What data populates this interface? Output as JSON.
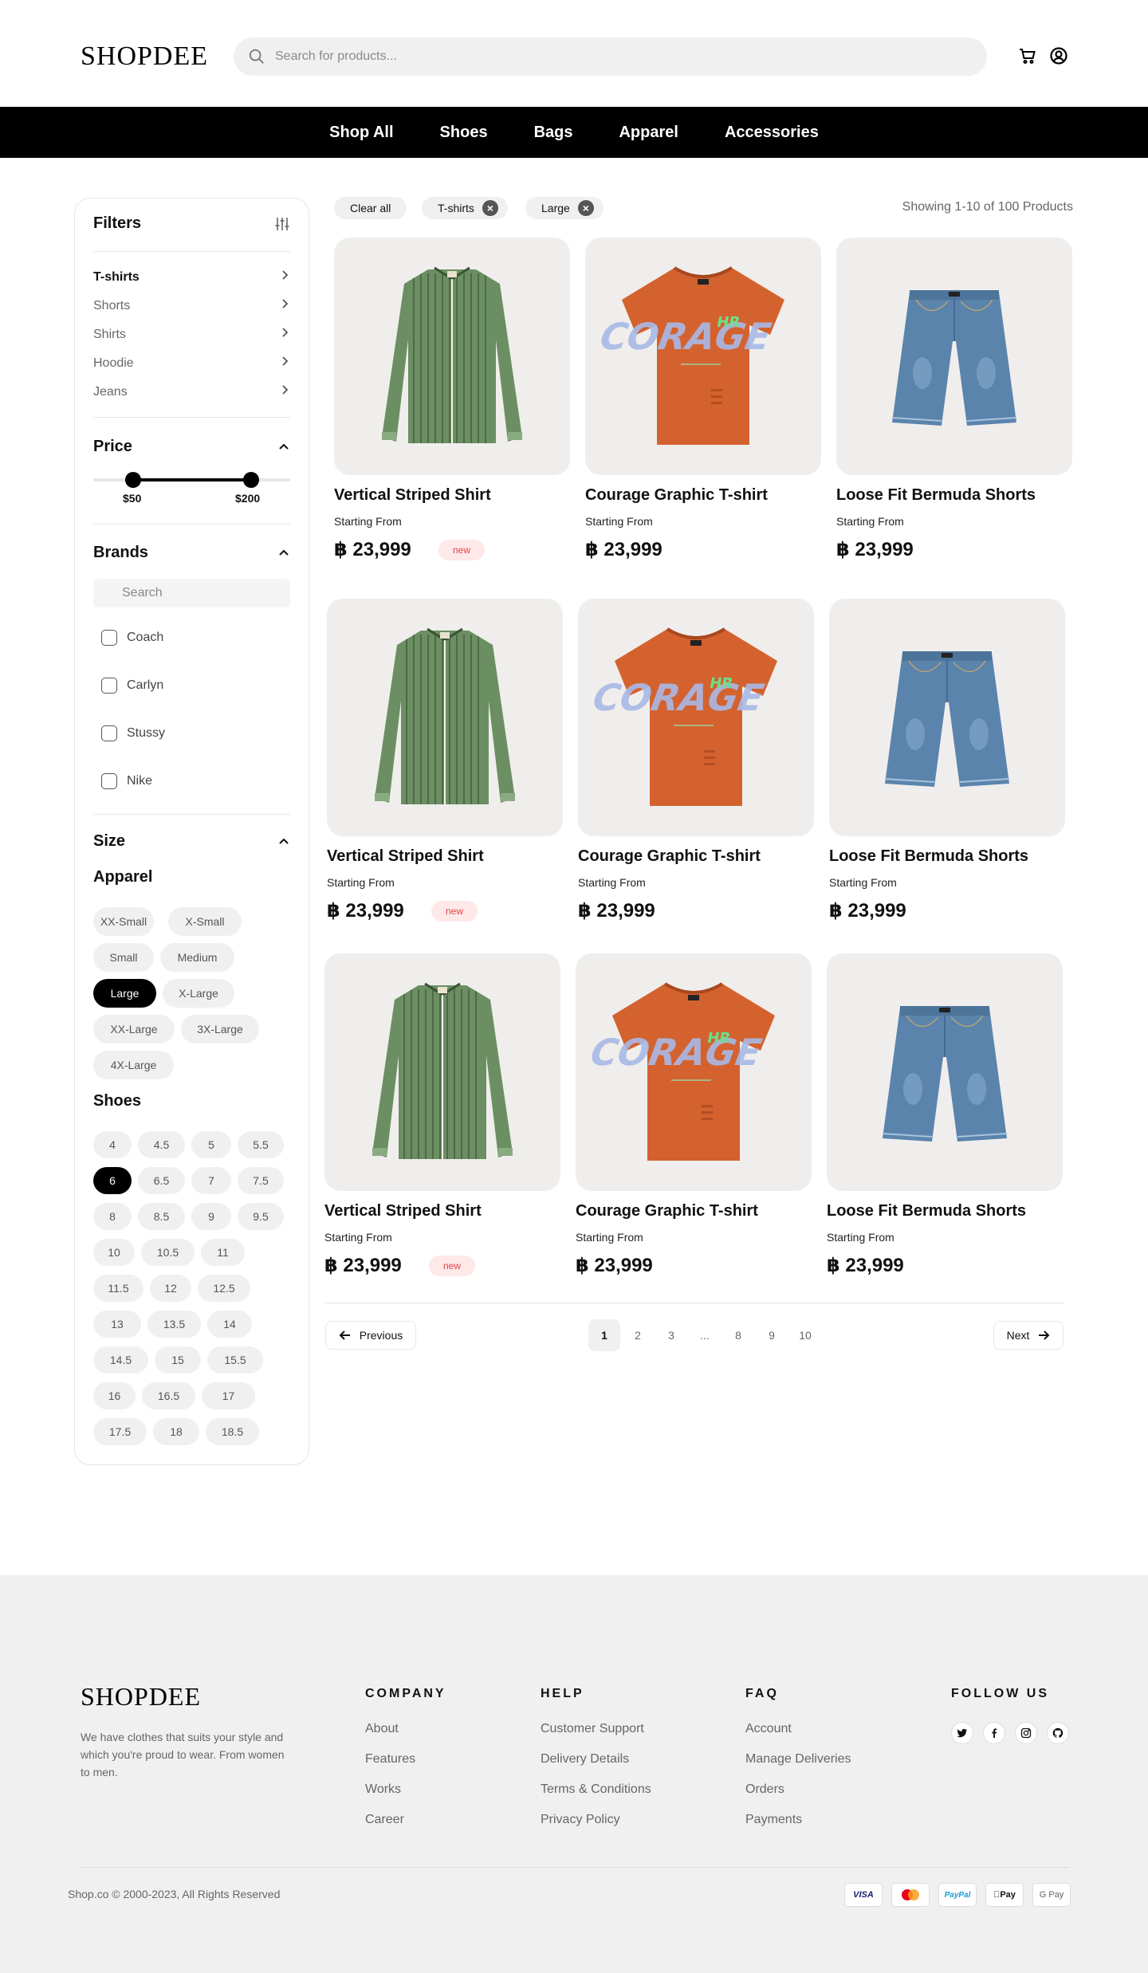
{
  "header": {
    "logo": "SHOPDEE",
    "search_placeholder": "Search for products...",
    "nav": [
      "Shop All",
      "Shoes",
      "Bags",
      "Apparel",
      "Accessories"
    ]
  },
  "filters": {
    "title": "Filters",
    "categories": [
      {
        "label": "T-shirts",
        "active": true
      },
      {
        "label": "Shorts",
        "active": false
      },
      {
        "label": "Shirts",
        "active": false
      },
      {
        "label": "Hoodie",
        "active": false
      },
      {
        "label": "Jeans",
        "active": false
      }
    ],
    "price": {
      "title": "Price",
      "min_label": "$50",
      "max_label": "$200"
    },
    "brands": {
      "title": "Brands",
      "search_placeholder": "Search",
      "items": [
        "Coach",
        "Carlyn",
        "Stussy",
        "Nike"
      ]
    },
    "size": {
      "title": "Size",
      "apparel_title": "Apparel",
      "apparel": [
        "XX-Small",
        "X-Small",
        "Small",
        "Medium",
        "Large",
        "X-Large",
        "XX-Large",
        "3X-Large",
        "4X-Large"
      ],
      "apparel_selected": "Large",
      "shoes_title": "Shoes",
      "shoes": [
        "4",
        "4.5",
        "5",
        "5.5",
        "6",
        "6.5",
        "7",
        "7.5",
        "8",
        "8.5",
        "9",
        "9.5",
        "10",
        "10.5",
        "11",
        "11.5",
        "12",
        "12.5",
        "13",
        "13.5",
        "14",
        "14.5",
        "15",
        "15.5",
        "16",
        "16.5",
        "17",
        "17.5",
        "18",
        "18.5"
      ],
      "shoes_selected": "6"
    }
  },
  "active_filters": {
    "clear_all": "Clear all",
    "chips": [
      "T-shirts",
      "Large"
    ],
    "showing": "Showing 1-10 of 100 Products"
  },
  "products": [
    {
      "name": "Vertical Striped Shirt",
      "from": "Starting From",
      "price": "฿ 23,999",
      "badge": "new",
      "kind": "shirt"
    },
    {
      "name": "Courage Graphic T-shirt",
      "from": "Starting From",
      "price": "฿ 23,999",
      "badge": "",
      "kind": "tee"
    },
    {
      "name": "Loose Fit Bermuda Shorts",
      "from": "Starting From",
      "price": "฿ 23,999",
      "badge": "",
      "kind": "shorts"
    },
    {
      "name": "Vertical Striped Shirt",
      "from": "Starting From",
      "price": "฿ 23,999",
      "badge": "new",
      "kind": "shirt"
    },
    {
      "name": "Courage Graphic T-shirt",
      "from": "Starting From",
      "price": "฿ 23,999",
      "badge": "",
      "kind": "tee"
    },
    {
      "name": "Loose Fit Bermuda Shorts",
      "from": "Starting From",
      "price": "฿ 23,999",
      "badge": "",
      "kind": "shorts"
    },
    {
      "name": "Vertical Striped Shirt",
      "from": "Starting From",
      "price": "฿ 23,999",
      "badge": "new",
      "kind": "shirt"
    },
    {
      "name": "Courage Graphic T-shirt",
      "from": "Starting From",
      "price": "฿ 23,999",
      "badge": "",
      "kind": "tee"
    },
    {
      "name": "Loose Fit Bermuda Shorts",
      "from": "Starting From",
      "price": "฿ 23,999",
      "badge": "",
      "kind": "shorts"
    }
  ],
  "pagination": {
    "previous": "Previous",
    "next": "Next",
    "pages": [
      "1",
      "2",
      "3",
      "...",
      "8",
      "9",
      "10"
    ],
    "current": "1"
  },
  "footer": {
    "logo": "SHOPDEE",
    "description": "We have clothes that suits your style and which you're proud to wear. From women to men.",
    "columns": [
      {
        "title": "COMPANY",
        "links": [
          "About",
          "Features",
          "Works",
          "Career"
        ]
      },
      {
        "title": "HELP",
        "links": [
          "Customer Support",
          "Delivery Details",
          "Terms & Conditions",
          "Privacy Policy"
        ]
      },
      {
        "title": "FAQ",
        "links": [
          "Account",
          "Manage Deliveries",
          "Orders",
          "Payments"
        ]
      }
    ],
    "follow_title": "FOLLOW US",
    "social": [
      "twitter-icon",
      "facebook-icon",
      "instagram-icon",
      "github-icon"
    ],
    "copyright": "Shop.co © 2000-2023, All Rights Reserved",
    "payments": [
      "VISA",
      "mastercard",
      "PayPal",
      "Pay",
      "G Pay"
    ]
  },
  "colors": {
    "accent": "#000000",
    "badge_text": "#e0464b",
    "badge_bg": "#ffe8e8",
    "shirt_green": "#6b8f62",
    "tee_orange": "#d4622e",
    "denim": "#5b84ad"
  }
}
